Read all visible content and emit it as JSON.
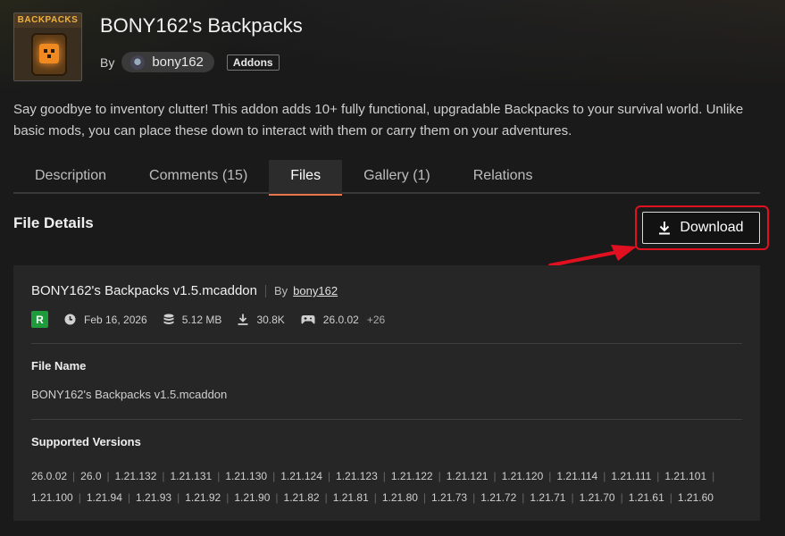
{
  "project": {
    "thumbnail_label": "BACKPACKS",
    "title": "BONY162's Backpacks",
    "by_label": "By",
    "author": "bony162",
    "category": "Addons",
    "summary": "Say goodbye to inventory clutter! This addon adds 10+ fully functional, upgradable Backpacks to your survival world. Unlike basic mods, you can place these down to interact with them or carry them on your adventures."
  },
  "tabs": [
    {
      "label": "Description",
      "active": false
    },
    {
      "label": "Comments (15)",
      "active": false
    },
    {
      "label": "Files",
      "active": true
    },
    {
      "label": "Gallery (1)",
      "active": false
    },
    {
      "label": "Relations",
      "active": false
    }
  ],
  "file_details": {
    "section_title": "File Details",
    "download_label": "Download",
    "file_title": "BONY162's Backpacks v1.5.mcaddon",
    "by_label": "By",
    "author": "bony162",
    "release_type": "R",
    "release_color": "#1e9b3a",
    "date": "Feb 16, 2026",
    "size": "5.12 MB",
    "downloads": "30.8K",
    "game_version": "26.0.02",
    "more_versions": "+26",
    "file_name_label": "File Name",
    "file_name": "BONY162's Backpacks v1.5.mcaddon",
    "supported_versions_label": "Supported Versions",
    "supported_versions_row1": [
      "26.0.02",
      "26.0",
      "1.21.132",
      "1.21.131",
      "1.21.130",
      "1.21.124",
      "1.21.123",
      "1.21.122",
      "1.21.121",
      "1.21.120",
      "1.21.114",
      "1.21.111",
      "1.21.101"
    ],
    "supported_versions_row2": [
      "1.21.100",
      "1.21.94",
      "1.21.93",
      "1.21.92",
      "1.21.90",
      "1.21.82",
      "1.21.81",
      "1.21.80",
      "1.21.73",
      "1.21.72",
      "1.21.71",
      "1.21.70",
      "1.21.61",
      "1.21.60"
    ]
  },
  "annotation": {
    "highlight_color": "#e01020"
  }
}
